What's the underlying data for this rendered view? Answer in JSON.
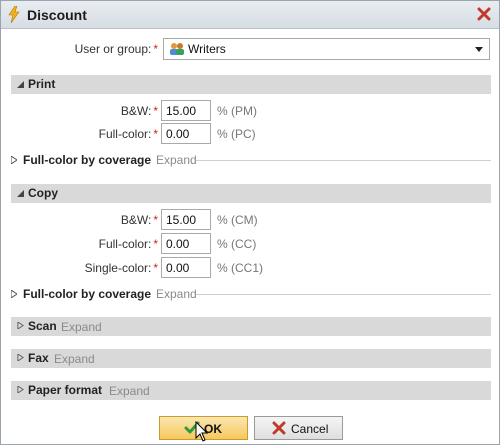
{
  "window": {
    "title": "Discount",
    "icon": "lightning-icon",
    "close_icon": "close-x-icon"
  },
  "user_group": {
    "label": "User or group:",
    "required_mark": "*",
    "value": "Writers",
    "value_icon": "users-group-icon"
  },
  "sections": {
    "print": {
      "title": "Print",
      "fields": [
        {
          "label": "B&W:",
          "value": "15.00",
          "unit": "% (PM)"
        },
        {
          "label": "Full-color:",
          "value": "0.00",
          "unit": "% (PC)"
        }
      ],
      "coverage": {
        "title": "Full-color by coverage",
        "expand": "Expand"
      }
    },
    "copy": {
      "title": "Copy",
      "fields": [
        {
          "label": "B&W:",
          "value": "15.00",
          "unit": "% (CM)"
        },
        {
          "label": "Full-color:",
          "value": "0.00",
          "unit": "% (CC)"
        },
        {
          "label": "Single-color:",
          "value": "0.00",
          "unit": "% (CC1)"
        }
      ],
      "coverage": {
        "title": "Full-color by coverage",
        "expand": "Expand"
      }
    },
    "scan": {
      "title": "Scan",
      "expand": "Expand"
    },
    "fax": {
      "title": "Fax",
      "expand": "Expand"
    },
    "paper_format": {
      "title": "Paper format",
      "expand": "Expand"
    }
  },
  "buttons": {
    "ok": {
      "label": "OK",
      "icon": "checkmark-icon"
    },
    "cancel": {
      "label": "Cancel",
      "icon": "cancel-x-icon"
    }
  },
  "colors": {
    "required": "#c62828",
    "section_bar": "#d9d9d9",
    "ok_button": "#f5c85b"
  }
}
